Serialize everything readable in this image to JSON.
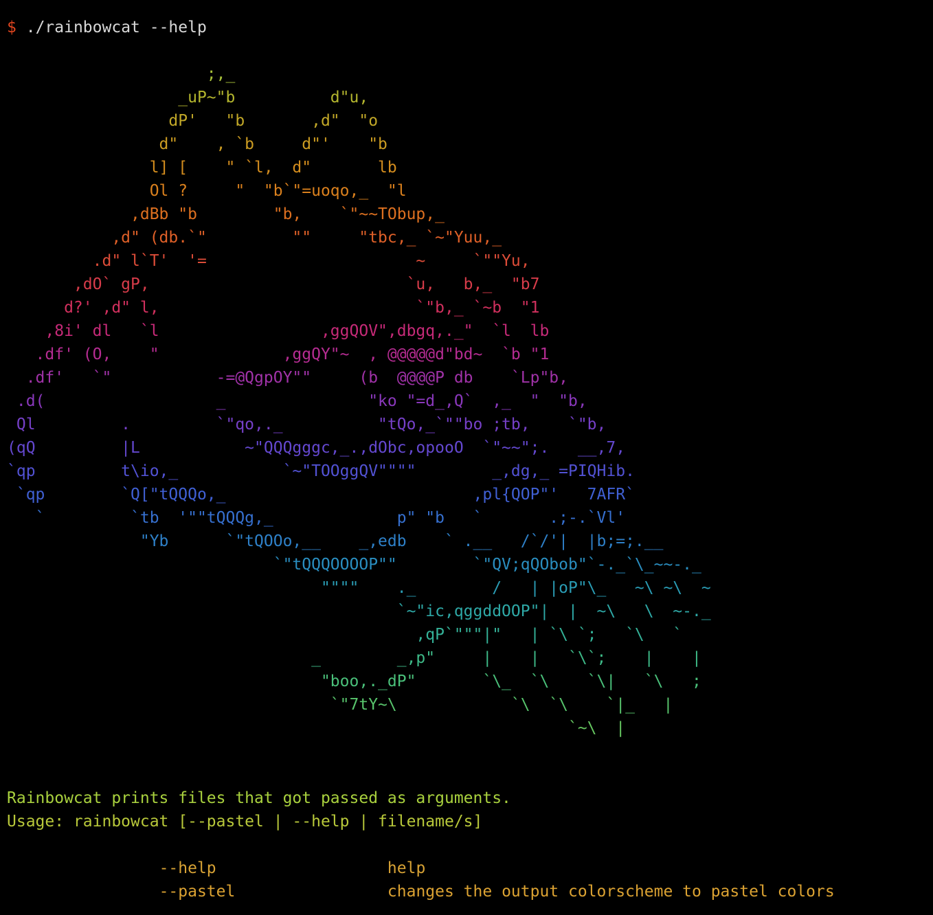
{
  "window": {
    "background": "#000000"
  },
  "prompt": {
    "symbol": "$",
    "command": "./rainbowcat --help",
    "symbol_color": "#e0451f",
    "command_color": "#d8d8d8"
  },
  "art": {
    "lines": [
      {
        "text": "                     ;,_",
        "color": "#a9c23a"
      },
      {
        "text": "                  _uP~\"b          d\"u,",
        "color": "#b3b52e"
      },
      {
        "text": "                 dP'   \"b       ,d\"  \"o",
        "color": "#c2a828"
      },
      {
        "text": "                d\"    , `b     d\"'    \"b",
        "color": "#cc9c22"
      },
      {
        "text": "               l] [    \" `l,  d\"       lb",
        "color": "#d48d1e"
      },
      {
        "text": "               Ol ?     \"  \"b`\"=uoqo,_  \"l",
        "color": "#da801d"
      },
      {
        "text": "             ,dBb \"b        \"b,    `\"~~TObup,_",
        "color": "#dd7020"
      },
      {
        "text": "           ,d\" (db.`\"         \"\"     \"tbc,_ `~\"Yuu,_",
        "color": "#df6028"
      },
      {
        "text": "         .d\" l`T'  '=                      ~     `\"\"Yu,",
        "color": "#dc4c38"
      },
      {
        "text": "       ,dO` gP,                           `u,   b,_  \"b7",
        "color": "#d83c4a"
      },
      {
        "text": "      d?' ,d\" l,                           `\"b,_ `~b  \"1",
        "color": "#d2305e"
      },
      {
        "text": "    ,8i' dl   `l                 ,ggQOV\",dbgq,._\"  `l  lb",
        "color": "#c62a78"
      },
      {
        "text": "   .df' (O,    \"             ,ggQY\"~  , @@@@@d\"bd~  `b \"1",
        "color": "#b52c92"
      },
      {
        "text": "  .df'   `\"           -=@QgpOY\"\"     (b  @@@@P db    `Lp\"b,",
        "color": "#a032a8"
      },
      {
        "text": " .d(                  _               \"ko \"=d_,Q`  ,_  \"  \"b,",
        "color": "#8a38bc"
      },
      {
        "text": " Ql         .         `\"qo,._          \"tQo,_`\"\"bo ;tb,    `\"b,",
        "color": "#7640c8"
      },
      {
        "text": "(qQ         |L           ~\"QQQgggc,_.,dObc,opooO  `\"~~\";.   __,7,",
        "color": "#6448d0"
      },
      {
        "text": "`qp         t\\io,_           `~\"TOOggQV\"\"\"\"        _,dg,_ =PIQHib.",
        "color": "#5252d4"
      },
      {
        "text": " `qp        `Q[\"tQQQo,_                          ,pl{QOP\"'   7AFR`",
        "color": "#4060d4"
      },
      {
        "text": "   `         `tb  '\"\"tQQQg,_             p\" \"b   `       .;-.`Vl'",
        "color": "#3670d0"
      },
      {
        "text": "              \"Yb      `\"tQOOo,__    _,edb    ` .__   /`/'|  |b;=;.__",
        "color": "#2e80c8"
      },
      {
        "text": "                            `\"tQQQOOOOP\"\"        `\"QV;qQObob\"`-._`\\_~~-._",
        "color": "#2a8ec0"
      },
      {
        "text": "                                 \"\"\"\"    ._        /   | |oP\"\\_   ~\\ ~\\  ~",
        "color": "#2a9cb4"
      },
      {
        "text": "                                         `~\"ic,qggddOOP\"|  |  ~\\   \\  ~-._",
        "color": "#2ea8a6"
      },
      {
        "text": "                                           ,qP`\"\"\"|\"   | `\\ `;   `\\   `",
        "color": "#34b298"
      },
      {
        "text": "                                _        _,p\"     |    |   `\\`;    |    |",
        "color": "#3eba88"
      },
      {
        "text": "                                 \"boo,._dP\"       `\\_  `\\    `\\|   `\\   ;",
        "color": "#4ac07a"
      },
      {
        "text": "                                  `\"7tY~\\            `\\  `\\    `|_   |",
        "color": "#58c46c"
      },
      {
        "text": "                                                           `~\\  |",
        "color": "#66c660"
      }
    ]
  },
  "help": {
    "description": "Rainbowcat prints files that got passed as arguments.",
    "description_color": "#a9d13e",
    "usage": "Usage: rainbowcat [--pastel | --help | filename/s]",
    "usage_color": "#b8c83a",
    "options": [
      {
        "flag": "--help",
        "desc": "help",
        "color": "#d7a235"
      },
      {
        "flag": "--pastel",
        "desc": "changes the output colorscheme to pastel colors",
        "color": "#dba232"
      }
    ]
  }
}
